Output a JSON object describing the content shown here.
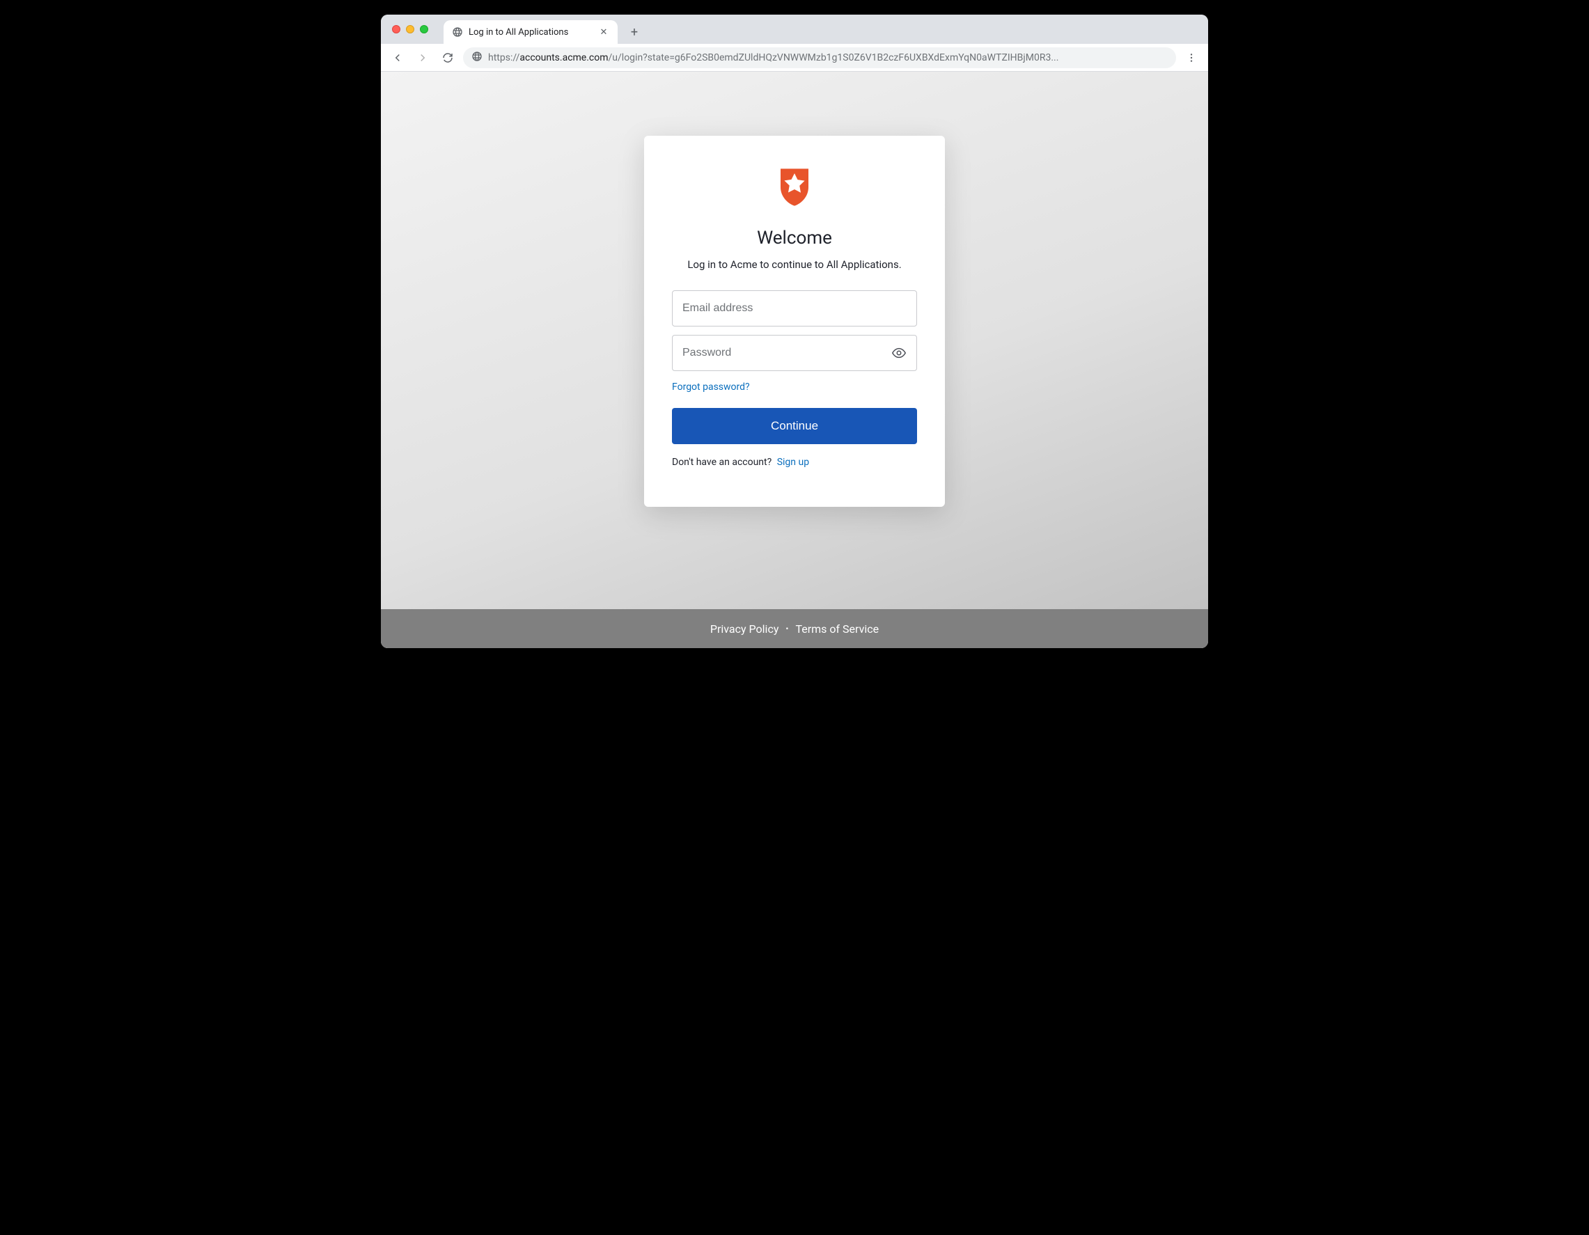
{
  "browser": {
    "tab": {
      "title": "Log in to All Applications"
    },
    "url": {
      "scheme": "https://",
      "host": "accounts.acme.com",
      "path": "/u/login?state=g6Fo2SB0emdZUldHQzVNWWMzb1g1S0Z6V1B2czF6UXBXdExmYqN0aWTZIHBjM0R3..."
    }
  },
  "login": {
    "heading": "Welcome",
    "subtitle": "Log in to Acme to continue to All Applications.",
    "email_placeholder": "Email address",
    "password_placeholder": "Password",
    "forgot_label": "Forgot password?",
    "continue_label": "Continue",
    "signup_prompt": "Don't have an account?",
    "signup_link": "Sign up"
  },
  "footer": {
    "privacy": "Privacy Policy",
    "terms": "Terms of Service"
  }
}
